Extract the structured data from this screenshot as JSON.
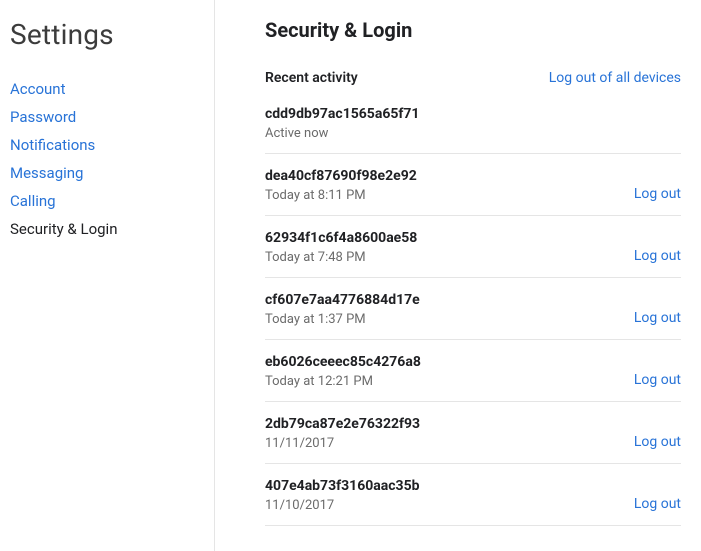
{
  "sidebar": {
    "title": "Settings",
    "items": [
      {
        "label": "Account",
        "active": false
      },
      {
        "label": "Password",
        "active": false
      },
      {
        "label": "Notifications",
        "active": false
      },
      {
        "label": "Messaging",
        "active": false
      },
      {
        "label": "Calling",
        "active": false
      },
      {
        "label": "Security & Login",
        "active": true
      }
    ]
  },
  "main": {
    "title": "Security & Login",
    "recent_label": "Recent activity",
    "logout_all_label": "Log out of all devices",
    "logout_label": "Log out",
    "sessions": [
      {
        "id": "cdd9db97ac1565a65f71",
        "time": "Active now",
        "current": true
      },
      {
        "id": "dea40cf87690f98e2e92",
        "time": "Today at 8:11 PM",
        "current": false
      },
      {
        "id": "62934f1c6f4a8600ae58",
        "time": "Today at 7:48 PM",
        "current": false
      },
      {
        "id": "cf607e7aa4776884d17e",
        "time": "Today at 1:37 PM",
        "current": false
      },
      {
        "id": "eb6026ceeec85c4276a8",
        "time": "Today at 12:21 PM",
        "current": false
      },
      {
        "id": "2db79ca87e2e76322f93",
        "time": "11/11/2017",
        "current": false
      },
      {
        "id": "407e4ab73f3160aac35b",
        "time": "11/10/2017",
        "current": false
      }
    ]
  }
}
